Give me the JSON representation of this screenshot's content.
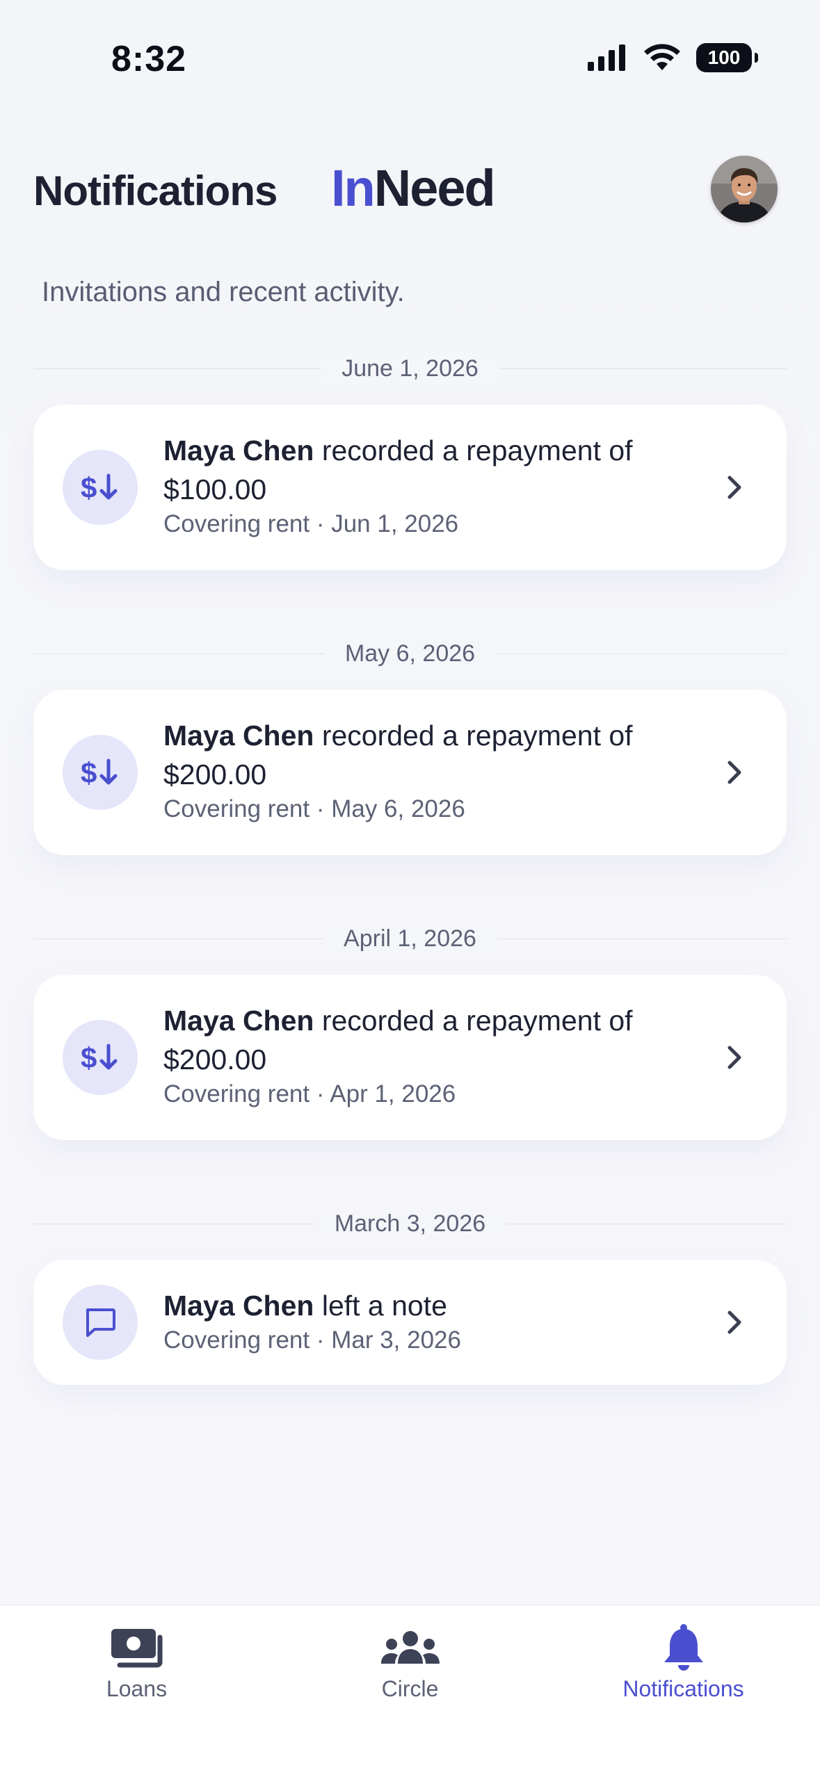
{
  "status_bar": {
    "time": "8:32",
    "battery": "100"
  },
  "header": {
    "title": "Notifications",
    "brand_part1": "In",
    "brand_part2": "Need",
    "avatar_icon": "user-avatar"
  },
  "subtitle": "Invitations and recent activity.",
  "groups": [
    {
      "date": "June 1, 2026",
      "item": {
        "icon": "dollar-down-icon",
        "name": "Maya Chen",
        "action": " recorded a repayment of $100.00",
        "meta": "Covering rent · Jun 1, 2026"
      }
    },
    {
      "date": "May 6, 2026",
      "item": {
        "icon": "dollar-down-icon",
        "name": "Maya Chen",
        "action": " recorded a repayment of $200.00",
        "meta": "Covering rent · May 6, 2026"
      }
    },
    {
      "date": "April 1, 2026",
      "item": {
        "icon": "dollar-down-icon",
        "name": "Maya Chen",
        "action": " recorded a repayment of $200.00",
        "meta": "Covering rent · Apr 1, 2026"
      }
    },
    {
      "date": "March 3, 2026",
      "item": {
        "icon": "chat-bubble-icon",
        "name": "Maya Chen",
        "action": " left a note",
        "meta": "Covering rent · Mar 3, 2026"
      }
    }
  ],
  "tabs": [
    {
      "label": "Loans",
      "icon": "loans-icon",
      "active": false
    },
    {
      "label": "Circle",
      "icon": "circle-people-icon",
      "active": false
    },
    {
      "label": "Notifications",
      "icon": "bell-icon",
      "active": true
    }
  ],
  "colors": {
    "accent": "#4a4fd0",
    "text": "#1d2132",
    "muted": "#5c6175",
    "icon_bg": "#e5e6f9",
    "background": "#f6f7fb"
  }
}
